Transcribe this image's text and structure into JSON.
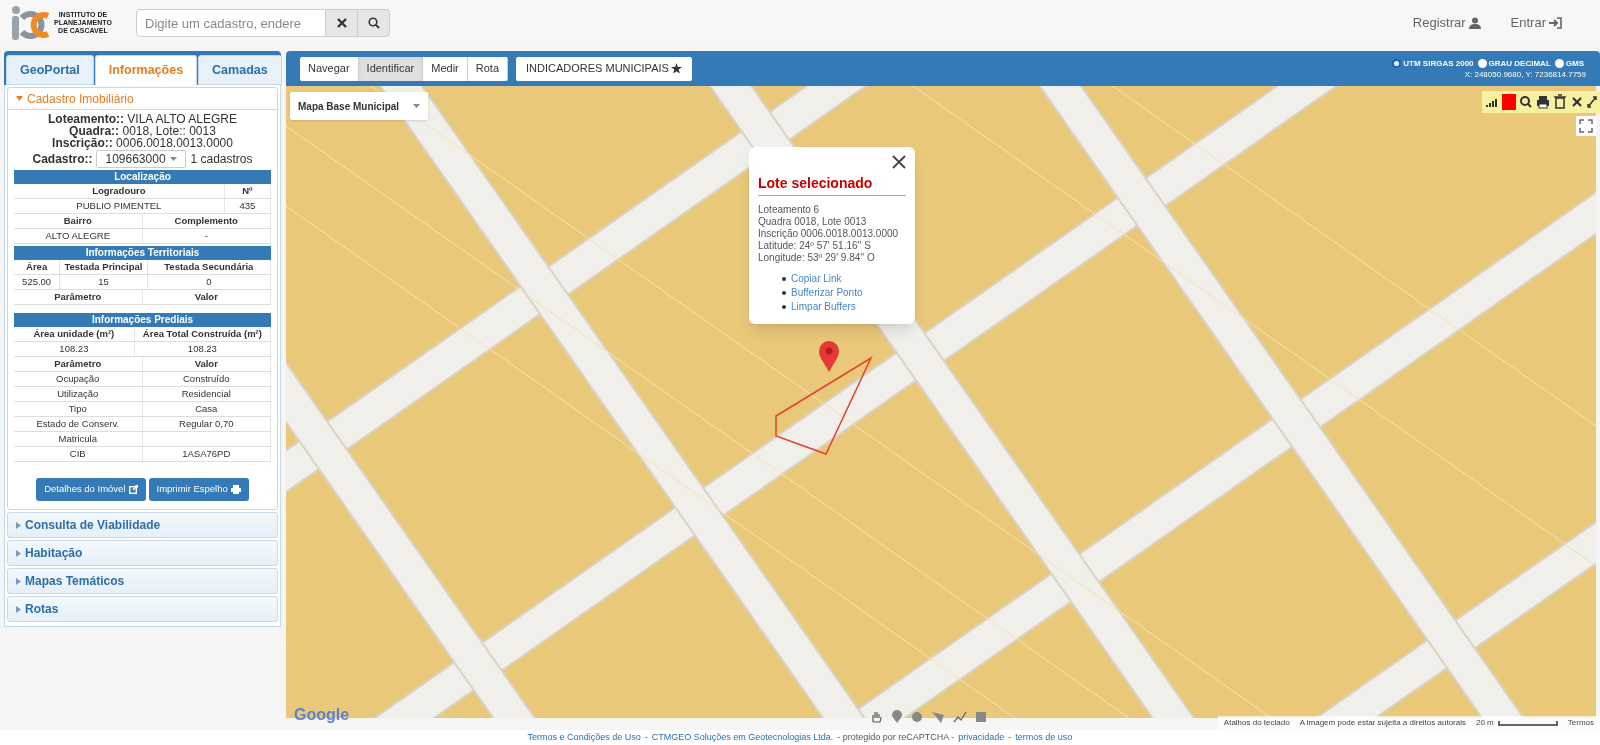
{
  "header": {
    "logo_lines": [
      "INSTITUTO DE",
      "PLANEJAMENTO",
      "DE CASCAVEL"
    ],
    "search": {
      "placeholder": "Digite um cadastro, endere"
    },
    "links": [
      "Registrar",
      "Entrar"
    ]
  },
  "sidebar": {
    "tabs": [
      {
        "label": "GeoPortal",
        "selected": false
      },
      {
        "label": "Informações",
        "selected": true
      },
      {
        "label": "Camadas",
        "selected": false
      }
    ],
    "accordion": [
      {
        "title": "Cadastro Imobiliário",
        "expanded": true
      },
      {
        "title": "Consulta de Viabilidade",
        "expanded": false
      },
      {
        "title": "Habitação",
        "expanded": false
      },
      {
        "title": "Mapas Temáticos",
        "expanded": false
      },
      {
        "title": "Rotas",
        "expanded": false
      }
    ],
    "cadastro": {
      "summary": [
        {
          "label": "Loteamento::",
          "value": "VILA ALTO ALEGRE"
        },
        {
          "label": "Quadra::",
          "value": "0018, Lote:: 0013"
        },
        {
          "label": "Inscrição::",
          "value": "0006.0018.0013.0000"
        }
      ],
      "select_label": "Cadastro::",
      "select_value": "109663000",
      "count": "1 cadastros",
      "sections": [
        {
          "title": "Localização",
          "blocks": [
            {
              "header": [
                "Logradouro",
                "Nº"
              ],
              "rows": [
                [
                  "PUBLIO PIMENTEL",
                  "435"
                ]
              ]
            },
            {
              "header": [
                "Bairro",
                "Complemento"
              ],
              "rows": [
                [
                  "ALTO ALEGRE",
                  "-"
                ]
              ]
            }
          ]
        },
        {
          "title": "Informações Territoriais",
          "blocks": [
            {
              "header": [
                "Área",
                "Testada Principal",
                "Testada Secundária"
              ],
              "rows": [
                [
                  "525.00",
                  "15",
                  "0"
                ]
              ]
            },
            {
              "header": [
                "Parâmetro",
                "Valor"
              ]
            }
          ]
        },
        {
          "title": "Informações Prediais",
          "blocks": [
            {
              "header": [
                "Área unidade (m²)",
                "Área Total Construída (m²)"
              ],
              "rows": [
                [
                  "108.23",
                  "108.23"
                ]
              ]
            },
            {
              "header": [
                "Parâmetro",
                "Valor"
              ],
              "rows": [
                [
                  "Ocupação",
                  "Construído"
                ],
                [
                  "Utilização",
                  "Residencial"
                ],
                [
                  "Tipo",
                  "Casa"
                ],
                [
                  "Estado de Conserv.",
                  "Regular 0,70"
                ],
                [
                  "Matricula"
                ],
                [
                  "CIB",
                  "1ASA76PD"
                ]
              ]
            }
          ]
        }
      ],
      "buttons": [
        "Detalhes do Imóvel",
        "Imprimir Espelho"
      ]
    }
  },
  "map_toolbar": {
    "tools": [
      {
        "label": "Navegar",
        "selected": false
      },
      {
        "label": "Identificar",
        "selected": true
      },
      {
        "label": "Medir",
        "selected": false
      },
      {
        "label": "Rota",
        "selected": false
      }
    ],
    "indicators": "INDICADORES MUNICIPAIS",
    "coordinate_systems": [
      {
        "label": "UTM SIRGAS 2000",
        "selected": true
      },
      {
        "label": "GRAU DECIMAL",
        "selected": false
      },
      {
        "label": "GMS",
        "selected": false
      }
    ],
    "coordinates": "X: 248050.9680, Y: 7236814.7759"
  },
  "map": {
    "layer_select": "Mapa Base Municipal",
    "popup": {
      "title": "Lote selecionado",
      "lines": [
        "Loteamento 6",
        "Quadra 0018, Lote 0013",
        "Inscrição 0006.0018.0013.0000",
        "Latitude: 24º 57' 51.16'' S",
        "Longitude: 53º 29' 9.84'' O"
      ],
      "links": [
        "Copiar Link",
        "Bufferizar Ponto",
        "Limpar Buffers"
      ]
    },
    "logo": "Google",
    "attribution": [
      "Atalhos do teclado",
      "A imagem pode estar sujeita a direitos autorais"
    ],
    "scale": "20 m",
    "terms": "Termos"
  },
  "footer": [
    {
      "kind": "link",
      "text": "Termos e Condições de Uso"
    },
    {
      "kind": "text",
      "text": "-"
    },
    {
      "kind": "link",
      "text": "CTMGEO Soluções em Geotecnologias Ltda."
    },
    {
      "kind": "text",
      "text": "- protegido por reCAPTCHA -"
    },
    {
      "kind": "link",
      "text": "privacidade"
    },
    {
      "kind": "text",
      "text": "-"
    },
    {
      "kind": "link",
      "text": "termos de uso"
    }
  ]
}
